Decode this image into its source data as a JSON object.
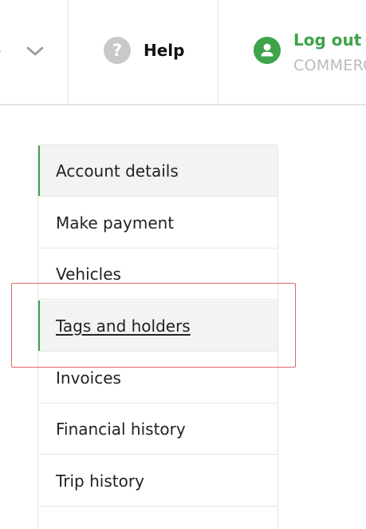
{
  "header": {
    "account_fragment": "s",
    "help_label": "Help",
    "logout_label": "Log out",
    "account_type": "COMMERCIAL"
  },
  "icons": {
    "account_menu": "chevron-down-icon",
    "help": "help-icon",
    "user": "user-icon"
  },
  "colors": {
    "brand_green": "#3ea34b",
    "highlight_red": "#e06666",
    "active_bg": "#f3f3f3"
  },
  "side_nav": {
    "items": [
      {
        "label": "Account details",
        "active": true
      },
      {
        "label": "Make payment",
        "active": false
      },
      {
        "label": "Vehicles",
        "active": false
      },
      {
        "label": "Tags and holders",
        "active": true,
        "current": true
      },
      {
        "label": "Invoices",
        "active": false
      },
      {
        "label": "Financial history",
        "active": false
      },
      {
        "label": "Trip history",
        "active": false
      }
    ]
  }
}
